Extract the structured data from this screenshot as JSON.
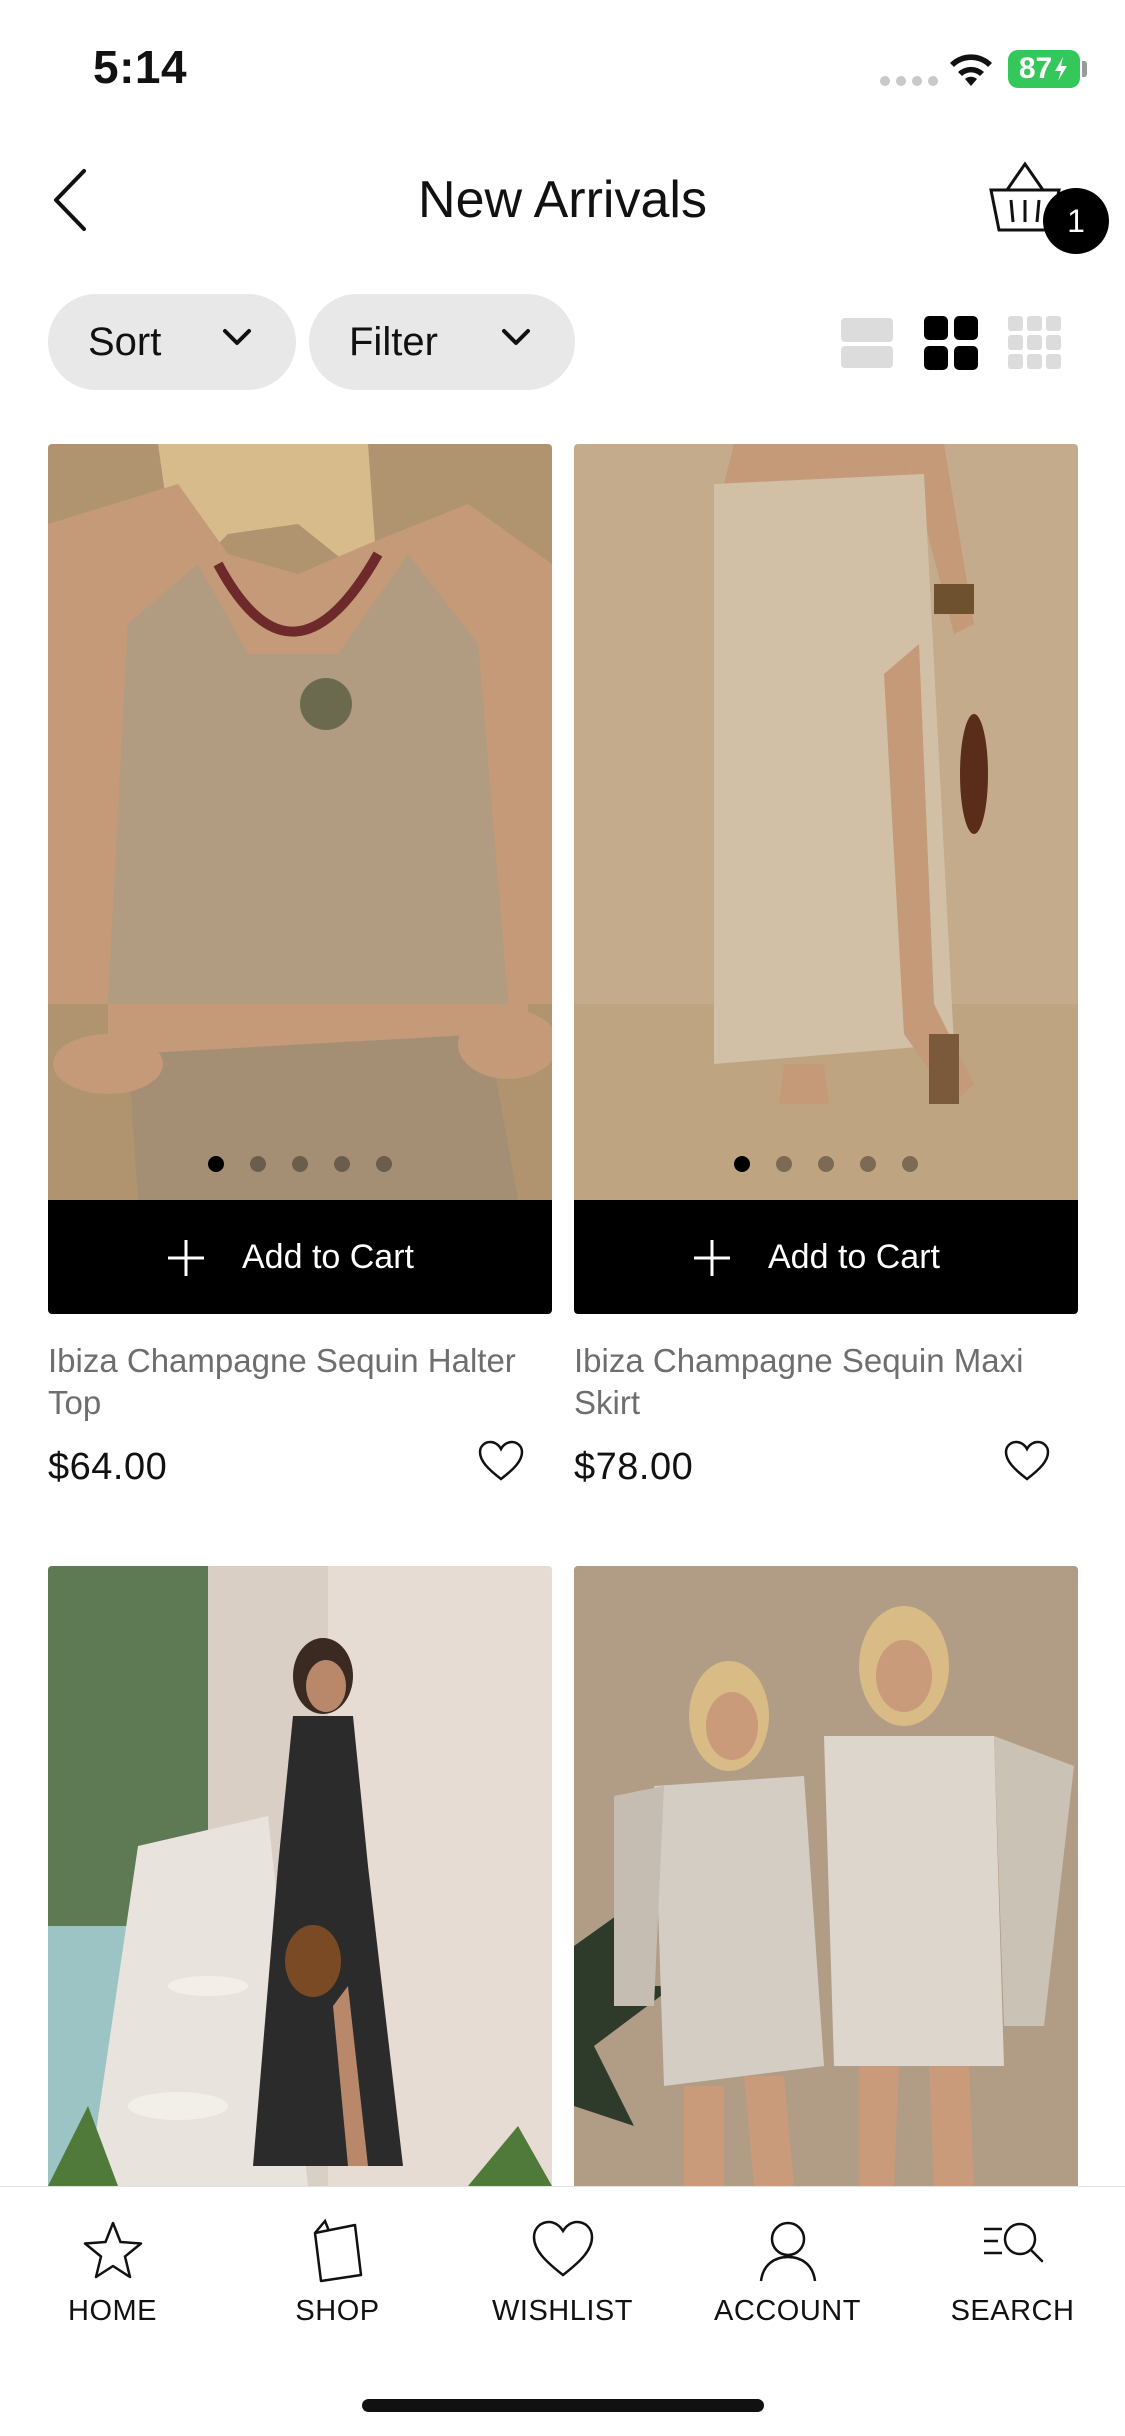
{
  "status_bar": {
    "time": "5:14",
    "battery": "87"
  },
  "header": {
    "title": "New Arrivals",
    "cart_count": "1"
  },
  "toolbar": {
    "sort_label": "Sort",
    "filter_label": "Filter"
  },
  "products": [
    {
      "name": "Ibiza Champagne Sequin Halter Top",
      "price": "$64.00",
      "add_to_cart": "Add to Cart"
    },
    {
      "name": "Ibiza Champagne Sequin Maxi Skirt",
      "price": "$78.00",
      "add_to_cart": "Add to Cart"
    }
  ],
  "tabbar": {
    "items": [
      {
        "label": "HOME",
        "icon": "star-icon"
      },
      {
        "label": "SHOP",
        "icon": "shopping-bag-icon"
      },
      {
        "label": "WISHLIST",
        "icon": "heart-icon"
      },
      {
        "label": "ACCOUNT",
        "icon": "user-icon"
      },
      {
        "label": "SEARCH",
        "icon": "search-icon"
      }
    ]
  }
}
